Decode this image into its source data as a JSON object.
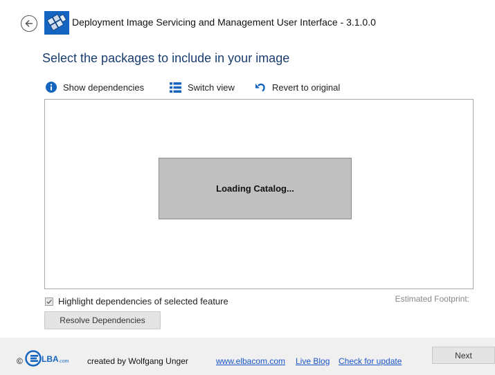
{
  "window": {
    "title": "Deployment Image Servicing and Management User Interface - 3.1.0.0",
    "back_icon": "back-arrow-icon",
    "app_icon": "app-logo-icon"
  },
  "page": {
    "heading": "Select the packages to include in your image"
  },
  "toolbar": {
    "show_dependencies": "Show dependencies",
    "switch_view": "Switch view",
    "revert": "Revert to original",
    "icons": [
      "info-icon",
      "list-view-icon",
      "undo-icon"
    ]
  },
  "catalog": {
    "loading_text": "Loading Catalog..."
  },
  "options": {
    "highlight_label": "Highlight dependencies of selected feature",
    "highlight_checked": true,
    "estimated_footprint": "Estimated Footprint:",
    "resolve_button": "Resolve Dependencies"
  },
  "footer": {
    "copyright_symbol": "©",
    "logo_text": "LBA",
    "logo_suffix": "com",
    "credit": "created by Wolfgang Unger",
    "links": [
      "www.elbacom.com",
      "Live Blog",
      "Check for update"
    ],
    "next_button": "Next"
  },
  "colors": {
    "heading": "#1a3d6e",
    "link": "#1a56c7",
    "accent_blue": "#1565c0",
    "loading_bg": "#c0c0c0",
    "footer_bg": "#f0f0f0"
  }
}
